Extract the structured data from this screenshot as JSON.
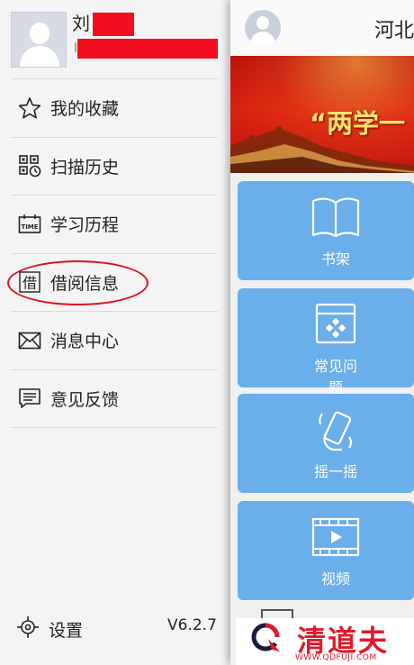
{
  "profile": {
    "name": "刘",
    "id": "l"
  },
  "menu": {
    "items": [
      {
        "label": "我的收藏",
        "icon": "star-icon"
      },
      {
        "label": "扫描历史",
        "icon": "qr-scan-icon"
      },
      {
        "label": "学习历程",
        "icon": "time-calendar-icon"
      },
      {
        "label": "借阅信息",
        "icon": "borrow-icon",
        "icon_char": "借",
        "highlighted": true
      },
      {
        "label": "消息中心",
        "icon": "mail-icon"
      },
      {
        "label": "意见反馈",
        "icon": "feedback-icon"
      }
    ]
  },
  "footer": {
    "settings_label": "设置",
    "version": "V6.2.7"
  },
  "main": {
    "title": "河北",
    "banner_text": "“两学一",
    "tiles": [
      {
        "label": "书架",
        "icon": "book-icon"
      },
      {
        "label": "常见问题",
        "icon": "faq-icon"
      },
      {
        "label": "摇一摇",
        "icon": "shake-phone-icon"
      },
      {
        "label": "视频",
        "icon": "video-icon"
      }
    ]
  },
  "watermark": {
    "text": "清道夫",
    "sub": "WWW.QDFUJI.COM"
  },
  "colors": {
    "tile": "#6aaeea",
    "annotation": "#e0101e",
    "redaction": "#f20d1f",
    "watermark": "#e01a2b"
  }
}
